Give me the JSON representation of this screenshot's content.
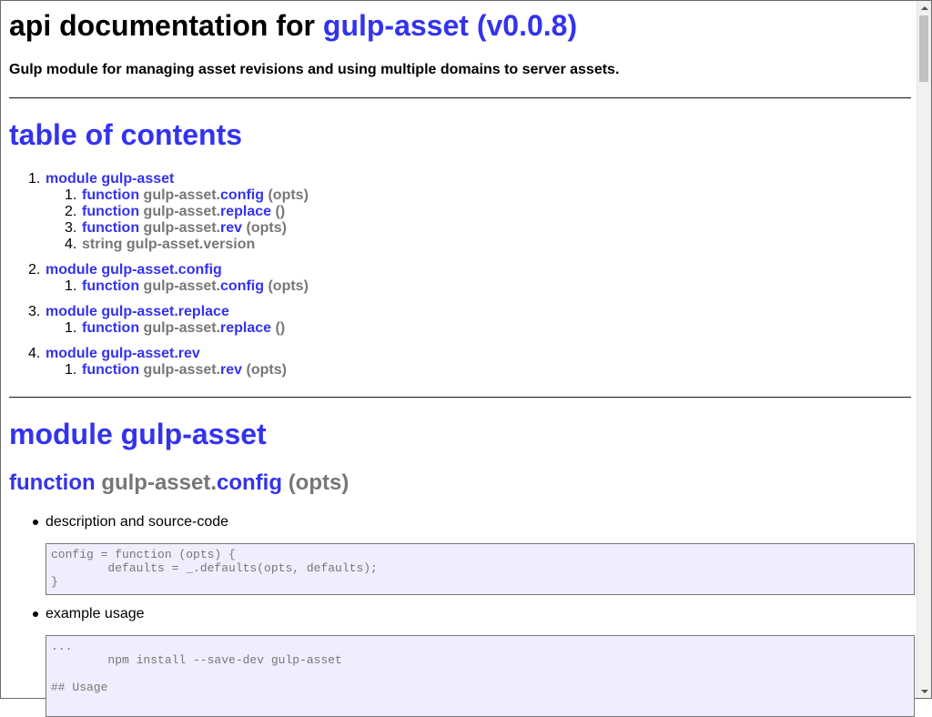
{
  "header": {
    "title_prefix": "api documentation for ",
    "title_link": "gulp-asset (v0.0.8)",
    "subtitle": "Gulp module for managing asset revisions and using multiple domains to server assets."
  },
  "toc": {
    "heading": "table of contents",
    "groups": [
      {
        "num": "1.",
        "label": "module gulp-asset",
        "items": [
          {
            "num": "1.",
            "keyword": "function",
            "prefix": "gulp-asset.",
            "name": "config",
            "args": "(opts)"
          },
          {
            "num": "2.",
            "keyword": "function",
            "prefix": "gulp-asset.",
            "name": "replace",
            "args": "()"
          },
          {
            "num": "3.",
            "keyword": "function",
            "prefix": "gulp-asset.",
            "name": "rev",
            "args": "(opts)"
          },
          {
            "num": "4.",
            "keyword": "string",
            "prefix": "gulp-asset.",
            "name": "version",
            "args": ""
          }
        ]
      },
      {
        "num": "2.",
        "label": "module gulp-asset.config",
        "items": [
          {
            "num": "1.",
            "keyword": "function",
            "prefix": "gulp-asset.",
            "name": "config",
            "args": "(opts)"
          }
        ]
      },
      {
        "num": "3.",
        "label": "module gulp-asset.replace",
        "items": [
          {
            "num": "1.",
            "keyword": "function",
            "prefix": "gulp-asset.",
            "name": "replace",
            "args": "()"
          }
        ]
      },
      {
        "num": "4.",
        "label": "module gulp-asset.rev",
        "items": [
          {
            "num": "1.",
            "keyword": "function",
            "prefix": "gulp-asset.",
            "name": "rev",
            "args": "(opts)"
          }
        ]
      }
    ]
  },
  "module": {
    "heading": "module gulp-asset",
    "function_heading": {
      "keyword": "function",
      "prefix": "gulp-asset.",
      "name": "config",
      "args": "(opts)"
    },
    "bullets": [
      {
        "label": "description and source-code",
        "code": "config = function (opts) {\n        defaults = _.defaults(opts, defaults);\n}"
      },
      {
        "label": "example usage",
        "code": "...\n        npm install --save-dev gulp-asset\n\n## Usage"
      }
    ]
  },
  "colors": {
    "link": "#3333ee",
    "muted": "#777777",
    "code_background": "#eeeeff"
  }
}
